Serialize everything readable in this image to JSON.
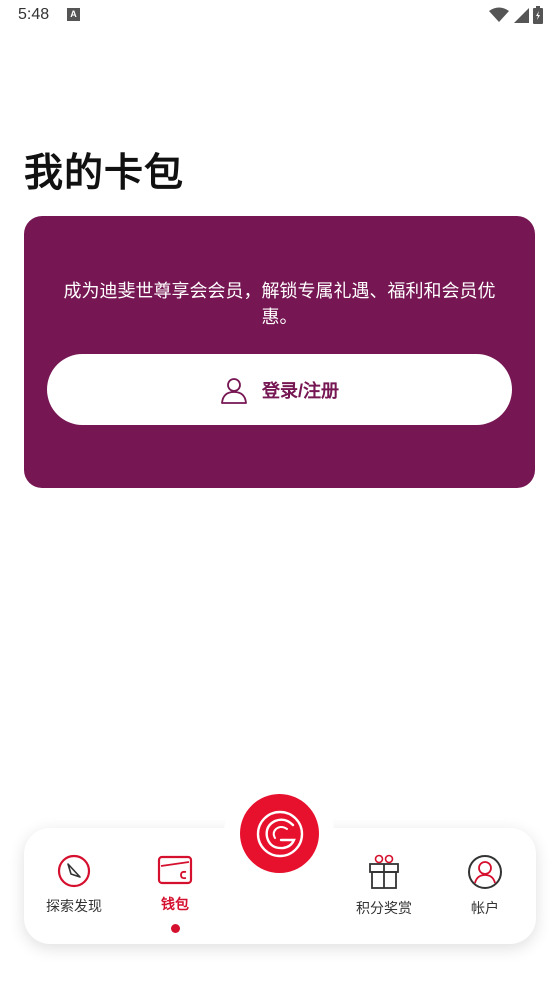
{
  "status_bar": {
    "time": "5:48",
    "notification_icon": "A",
    "icons": [
      "wifi-icon",
      "signal-icon",
      "battery-icon"
    ]
  },
  "page": {
    "title": "我的卡包"
  },
  "member_card": {
    "message": "成为迪斐世尊享会会员，解锁专属礼遇、福利和会员优惠。",
    "login_button": {
      "icon": "user-icon",
      "label": "登录/注册"
    }
  },
  "tab_bar": {
    "items": [
      {
        "label": "探索发现",
        "icon": "compass-icon",
        "active": false
      },
      {
        "label": "钱包",
        "icon": "wallet-icon",
        "active": true
      },
      {
        "label": "积分奖赏",
        "icon": "gift-icon",
        "active": false
      },
      {
        "label": "帐户",
        "icon": "account-icon",
        "active": false
      }
    ],
    "center_button_icon": "brand-logo-icon"
  },
  "colors": {
    "card_background": "#761653",
    "accent_red": "#e7102d",
    "active_tab": "#d5102e"
  }
}
